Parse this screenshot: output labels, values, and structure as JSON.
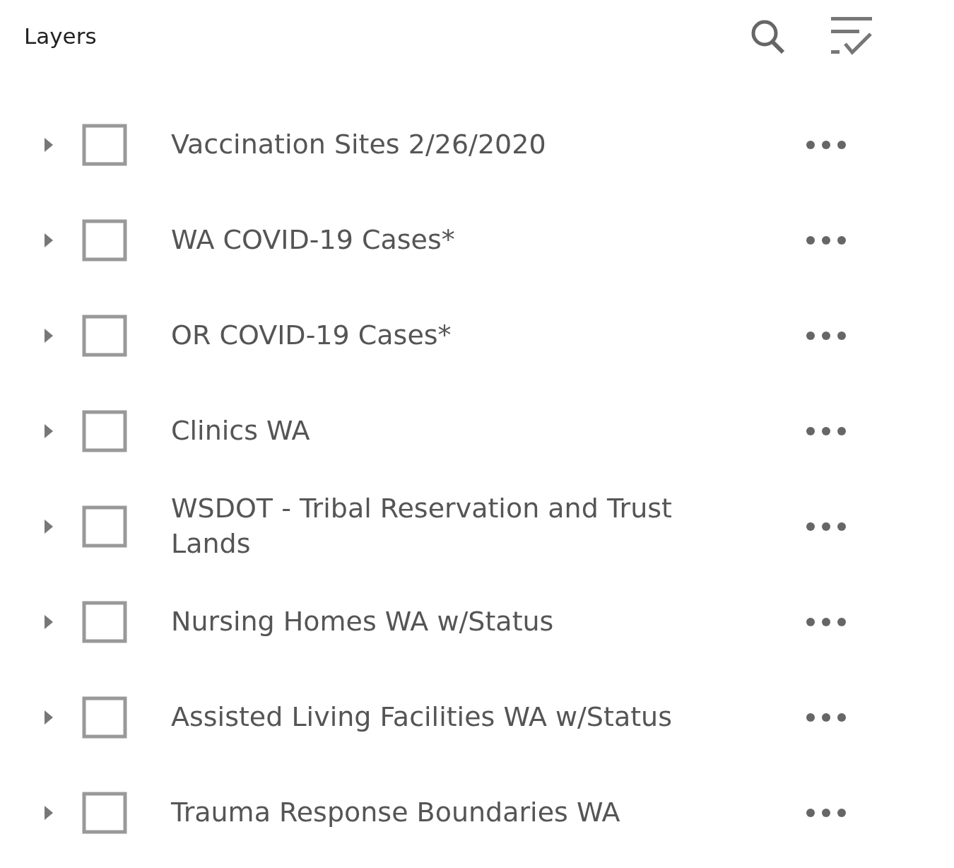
{
  "panel": {
    "title": "Layers"
  },
  "layers": [
    {
      "name": "Vaccination Sites 2/26/2020",
      "checked": false,
      "expanded": false
    },
    {
      "name": "WA COVID-19 Cases*",
      "checked": false,
      "expanded": false
    },
    {
      "name": "OR COVID-19 Cases*",
      "checked": false,
      "expanded": false
    },
    {
      "name": "Clinics WA",
      "checked": false,
      "expanded": false
    },
    {
      "name": "WSDOT - Tribal Reservation and Trust Lands",
      "checked": false,
      "expanded": false
    },
    {
      "name": "Nursing Homes WA w/Status",
      "checked": false,
      "expanded": false
    },
    {
      "name": "Assisted Living Facilities WA w/Status",
      "checked": false,
      "expanded": false
    },
    {
      "name": "Trauma Response Boundaries WA",
      "checked": false,
      "expanded": false
    }
  ]
}
